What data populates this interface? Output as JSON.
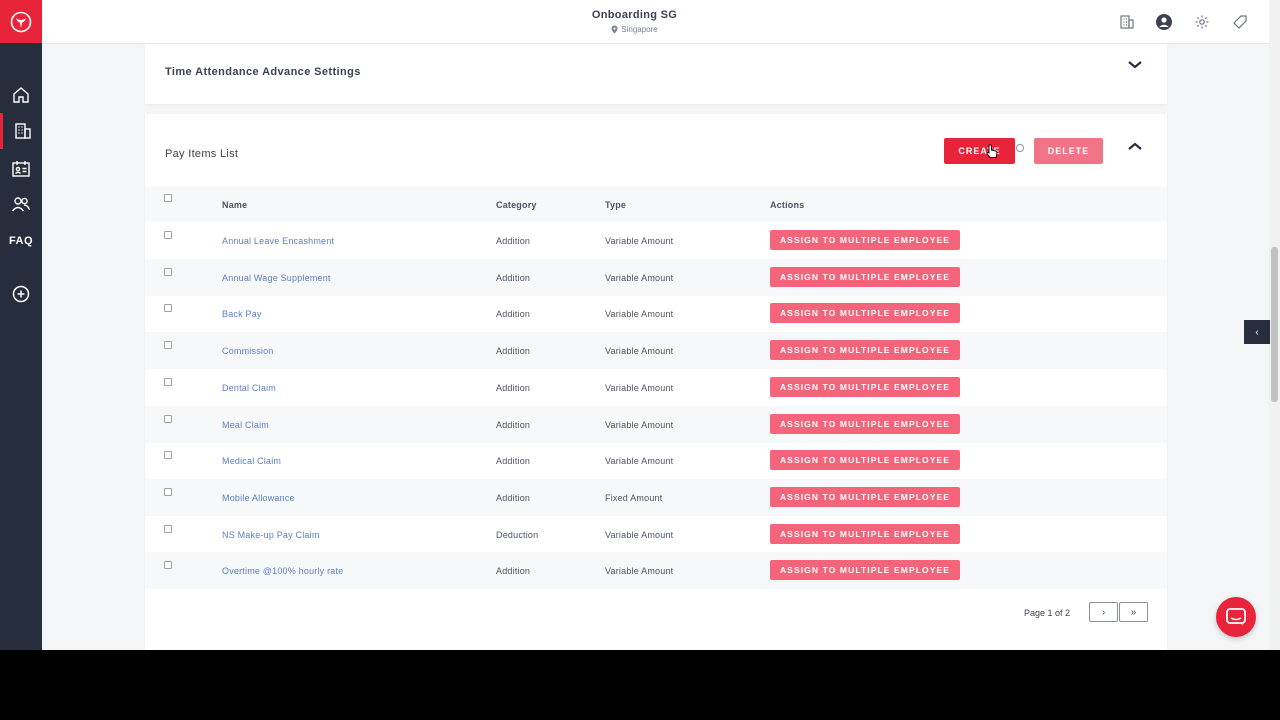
{
  "header": {
    "company": "Onboarding SG",
    "location": "Singapore"
  },
  "sidebar": {
    "items": [
      {
        "icon": "home-icon"
      },
      {
        "icon": "building-icon",
        "active": true
      },
      {
        "icon": "id-card-icon"
      },
      {
        "icon": "users-icon"
      },
      {
        "label": "FAQ"
      },
      {
        "icon": "plus-circle-icon"
      }
    ]
  },
  "sections": {
    "time_attendance": {
      "title": "Time Attendance Advance Settings"
    },
    "pay_items": {
      "title": "Pay Items List",
      "create_label": "CREATE",
      "delete_label": "DELETE"
    }
  },
  "table": {
    "headers": {
      "name": "Name",
      "category": "Category",
      "type": "Type",
      "actions": "Actions"
    },
    "action_label": "ASSIGN TO MULTIPLE EMPLOYEE",
    "rows": [
      {
        "name": "Annual Leave Encashment",
        "category": "Addition",
        "type": "Variable Amount"
      },
      {
        "name": "Annual Wage Supplement",
        "category": "Addition",
        "type": "Variable Amount"
      },
      {
        "name": "Back Pay",
        "category": "Addition",
        "type": "Variable Amount"
      },
      {
        "name": "Commission",
        "category": "Addition",
        "type": "Variable Amount"
      },
      {
        "name": "Dental Claim",
        "category": "Addition",
        "type": "Variable Amount"
      },
      {
        "name": "Meal Claim",
        "category": "Addition",
        "type": "Variable Amount"
      },
      {
        "name": "Medical Claim",
        "category": "Addition",
        "type": "Variable Amount"
      },
      {
        "name": "Mobile Allowance",
        "category": "Addition",
        "type": "Fixed Amount"
      },
      {
        "name": "NS Make-up Pay Claim",
        "category": "Deduction",
        "type": "Variable Amount"
      },
      {
        "name": "Overtime @100% hourly rate",
        "category": "Addition",
        "type": "Variable Amount"
      }
    ]
  },
  "pagination": {
    "info": "Page 1 of 2",
    "next": "›",
    "last": "»"
  },
  "floating": {
    "side_toggle": "‹"
  },
  "colors": {
    "brand": "#e8243a",
    "sidebar": "#262d3d",
    "assign_button": "#f4647a",
    "link": "#5c7fc4"
  }
}
